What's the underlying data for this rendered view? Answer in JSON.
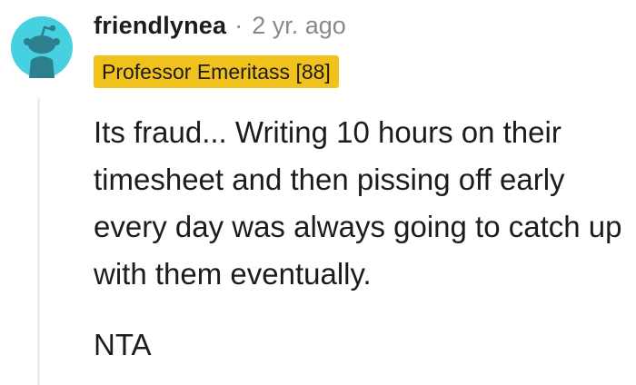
{
  "comment": {
    "username": "friendlynea",
    "separator": "·",
    "timestamp": "2 yr. ago",
    "flair": "Professor Emeritass [88]",
    "paragraphs": [
      "Its fraud... Writing 10 hours on their timesheet and then pissing off early every day was always going to catch up with them eventually.",
      "NTA"
    ]
  },
  "colors": {
    "avatar_bg": "#46d0e0",
    "avatar_figure": "#2c7f8c",
    "flair_bg": "#f1c21b",
    "muted_text": "#878a8c",
    "thread_line": "#ededed"
  },
  "icons": {
    "avatar": "reddit-snoo-avatar-icon"
  }
}
